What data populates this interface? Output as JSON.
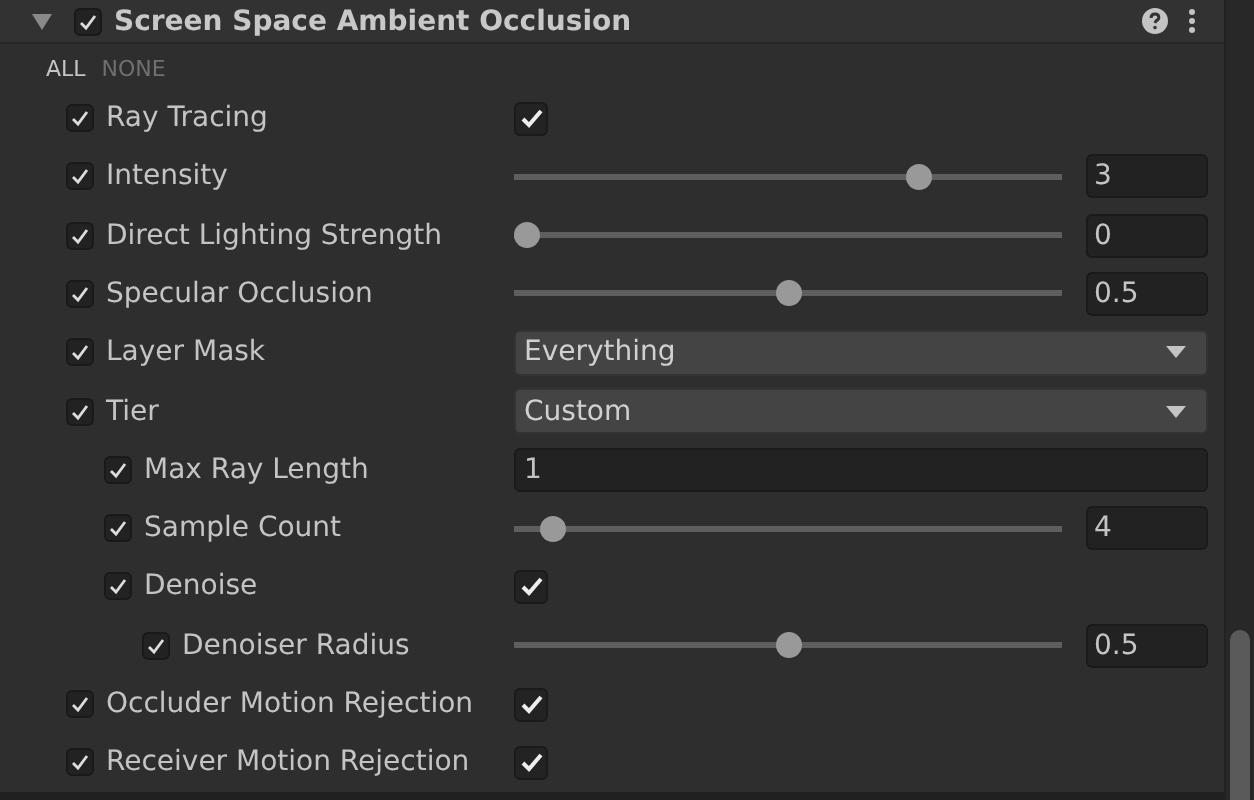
{
  "header": {
    "title": "Screen Space Ambient Occlusion",
    "expanded": true,
    "enabled": true
  },
  "select_links": [
    {
      "label": "ALL",
      "selected": true
    },
    {
      "label": "NONE",
      "selected": false
    }
  ],
  "rows": [
    {
      "label": "Ray Tracing",
      "override": true,
      "kind": "toggle",
      "checked": true
    },
    {
      "label": "Intensity",
      "override": true,
      "kind": "slider",
      "level": 0.75,
      "value": "3"
    },
    {
      "label": "Direct Lighting Strength",
      "override": true,
      "kind": "slider",
      "level": 0,
      "value": "0"
    },
    {
      "label": "Specular Occlusion",
      "override": true,
      "kind": "slider",
      "level": 0.5,
      "value": "0.5"
    },
    {
      "label": "Layer Mask",
      "override": true,
      "kind": "dropdown",
      "value": "Everything"
    },
    {
      "label": "Tier",
      "override": true,
      "kind": "dropdown",
      "value": "Custom",
      "children": [
        {
          "label": "Max Ray Length",
          "override": true,
          "kind": "field",
          "value": "1"
        },
        {
          "label": "Sample Count",
          "override": true,
          "kind": "slider",
          "level": 0.05,
          "value": "4"
        },
        {
          "label": "Denoise",
          "override": true,
          "kind": "toggle",
          "checked": true,
          "children": [
            {
              "label": "Denoiser Radius",
              "override": true,
              "kind": "slider",
              "level": 0.5,
              "value": "0.5"
            }
          ]
        }
      ]
    },
    {
      "label": "Occluder Motion Rejection",
      "override": true,
      "kind": "toggle",
      "checked": true
    },
    {
      "label": "Receiver Motion Rejection",
      "override": true,
      "kind": "toggle",
      "checked": true
    }
  ]
}
